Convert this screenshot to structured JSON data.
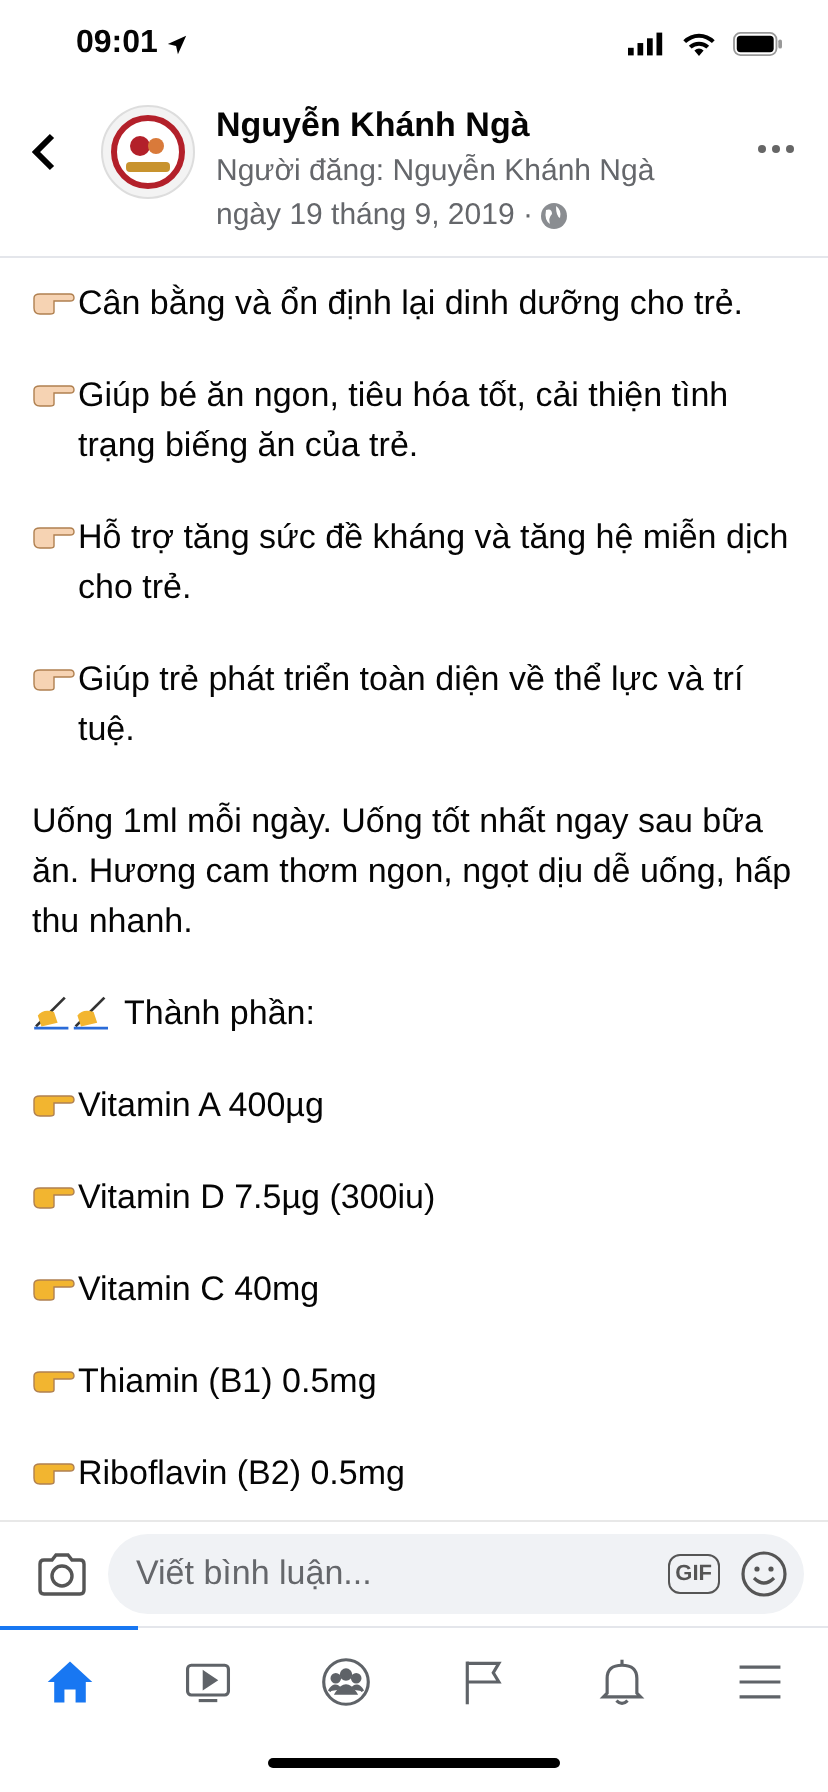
{
  "status_bar": {
    "time": "09:01"
  },
  "post_header": {
    "author": "Nguyễn Khánh Ngà",
    "posted_by": "Người đăng: Nguyễn Khánh Ngà",
    "date": "ngày 19 tháng 9, 2019 ·"
  },
  "paragraphs": [
    {
      "kind": "bullet",
      "text": "Cân bằng và ổn định lại dinh dưỡng cho trẻ."
    },
    {
      "kind": "bullet",
      "text": "Giúp bé ăn ngon, tiêu hóa tốt, cải thiện tình trạng biếng ăn của trẻ."
    },
    {
      "kind": "bullet",
      "text": "Hỗ trợ tăng sức đề kháng và tăng hệ miễn dịch cho trẻ."
    },
    {
      "kind": "bullet",
      "text": "Giúp trẻ phát triển toàn diện về thể lực và trí tuệ."
    },
    {
      "kind": "plain",
      "text": "Uống 1ml mỗi ngày. Uống tốt nhất ngay sau bữa ăn. Hương cam thơm ngon, ngọt dịu dễ uống, hấp thu nhanh."
    },
    {
      "kind": "heading",
      "text": "Thành phần:"
    },
    {
      "kind": "vitamin",
      "text": "Vitamin A 400µg"
    },
    {
      "kind": "vitamin",
      "text": "Vitamin D 7.5µg (300iu)"
    },
    {
      "kind": "vitamin",
      "text": "Vitamin C 40mg"
    },
    {
      "kind": "vitamin",
      "text": "Thiamin (B1) 0.5mg"
    },
    {
      "kind": "vitamin",
      "text": "Riboflavin (B2) 0.5mg"
    }
  ],
  "comment_bar": {
    "placeholder": "Viết bình luận...",
    "gif_label": "GIF"
  },
  "nav_tabs": [
    {
      "kind": "home",
      "selected": true
    },
    {
      "kind": "video",
      "selected": false
    },
    {
      "kind": "groups",
      "selected": false
    },
    {
      "kind": "pages",
      "selected": false
    },
    {
      "kind": "bell",
      "selected": false
    },
    {
      "kind": "menu",
      "selected": false
    }
  ]
}
